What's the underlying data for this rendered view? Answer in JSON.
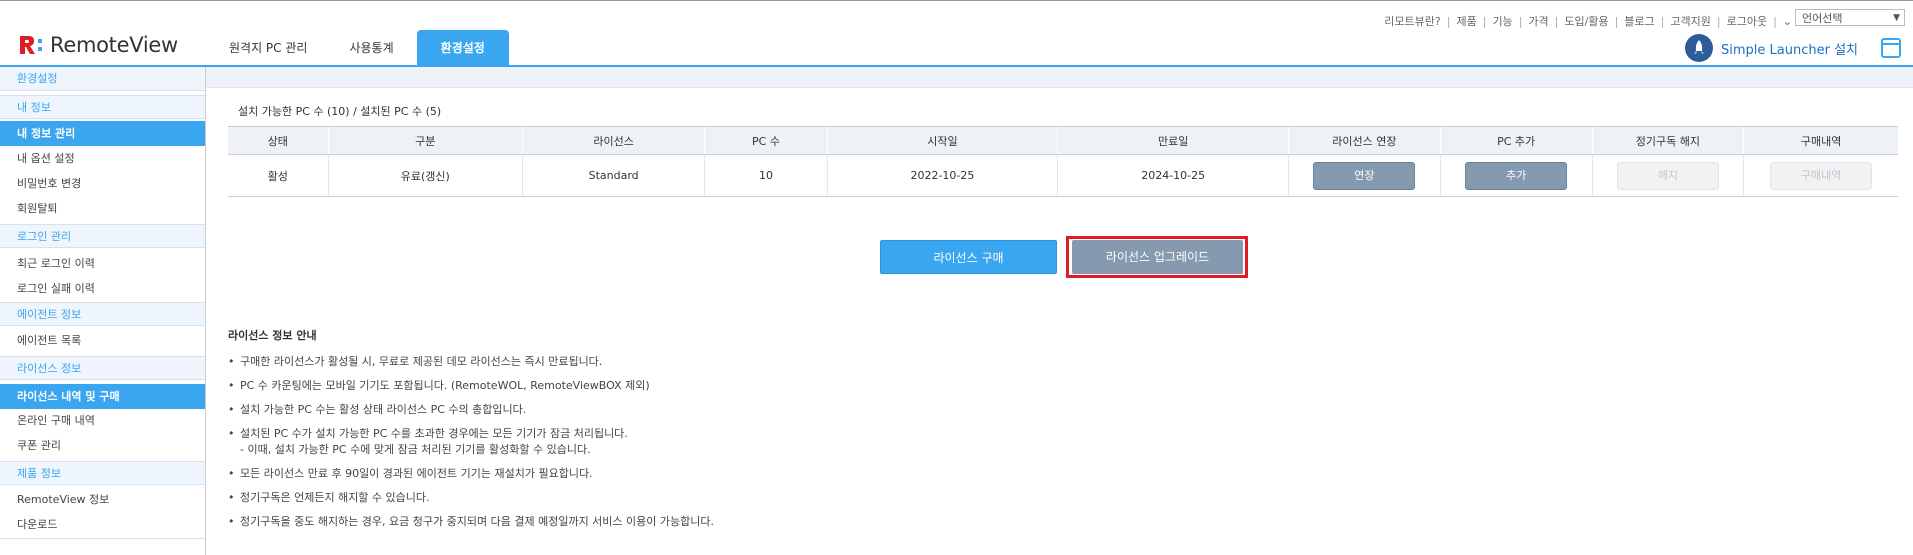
{
  "brand": {
    "name": "RemoteView",
    "accent": "#3aa6ef",
    "alert": "#e01b24"
  },
  "topnav": [
    "리모트뷰란?",
    "제품",
    "기능",
    "가격",
    "도입/활용",
    "블로그",
    "고객지원",
    "로그아웃"
  ],
  "language": {
    "value": "언어선택"
  },
  "mainnav": [
    {
      "label": "원격지 PC 관리",
      "active": false
    },
    {
      "label": "사용통계",
      "active": false
    },
    {
      "label": "환경설정",
      "active": true
    }
  ],
  "launcher": {
    "label": "Simple Launcher 설치"
  },
  "sidebar": {
    "title": "환경설정",
    "groups": [
      {
        "section": "내 정보",
        "items": [
          "내 정보 관리",
          "내 옵션 설정",
          "비밀번호 변경",
          "회원탈퇴"
        ]
      },
      {
        "section": "로그인 관리",
        "items": [
          "최근 로그인 이력",
          "로그인 실패 이력"
        ]
      },
      {
        "section": "에이전트 정보",
        "items": [
          "에이전트 목록"
        ]
      },
      {
        "section": "라이선스 정보",
        "items": [
          "라이선스 내역 및 구매",
          "온라인 구매 내역",
          "쿠폰 관리"
        ]
      },
      {
        "section": "제품 정보",
        "items": [
          "RemoteView 정보",
          "다운로드"
        ]
      }
    ],
    "active_items": [
      "내 정보 관리",
      "라이선스 내역 및 구매"
    ]
  },
  "summary": "설치 가능한 PC 수 (10) / 설치된 PC 수 (5)",
  "table": {
    "headers": [
      "상태",
      "구분",
      "라이선스",
      "PC 수",
      "시작일",
      "만료일",
      "라이선스 연장",
      "PC 추가",
      "정기구독 해지",
      "구매내역"
    ],
    "row": {
      "status": "활성",
      "type": "유료(갱신)",
      "license": "Standard",
      "pc_count": "10",
      "start": "2022-10-25",
      "end": "2024-10-25",
      "extend": "연장",
      "add_pc": "추가",
      "cancel": "해지",
      "history": "구매내역"
    }
  },
  "actions": {
    "buy": "라이선스 구매",
    "upgrade": "라이선스 업그레이드"
  },
  "info": {
    "title": "라이선스 정보 안내",
    "items": [
      "구매한 라이선스가 활성될 시, 무료로 제공된 데모 라이선스는 즉시 만료됩니다.",
      "PC 수 카운팅에는 모바일 기기도 포함됩니다. (RemoteWOL, RemoteViewBOX 제외)",
      "설치 가능한 PC 수는 활성 상태 라이선스 PC 수의 총합입니다.",
      "설치된 PC 수가 설치 가능한 PC 수를 초과한 경우에는 모든 기기가 잠금 처리됩니다.",
      "모든 라이선스 만료 후 90일이 경과된 에이전트 기기는 재설치가 필요합니다.",
      "정기구독은 언제든지 해지할 수 있습니다.",
      "정기구독을 중도 해지하는 경우, 요금 청구가 중지되며 다음 결제 예정일까지 서비스 이용이 가능합니다."
    ],
    "sub": "- 이때, 설치 가능한 PC 수에 맞게 잠금 처리된 기기를 활성화할 수 있습니다."
  }
}
